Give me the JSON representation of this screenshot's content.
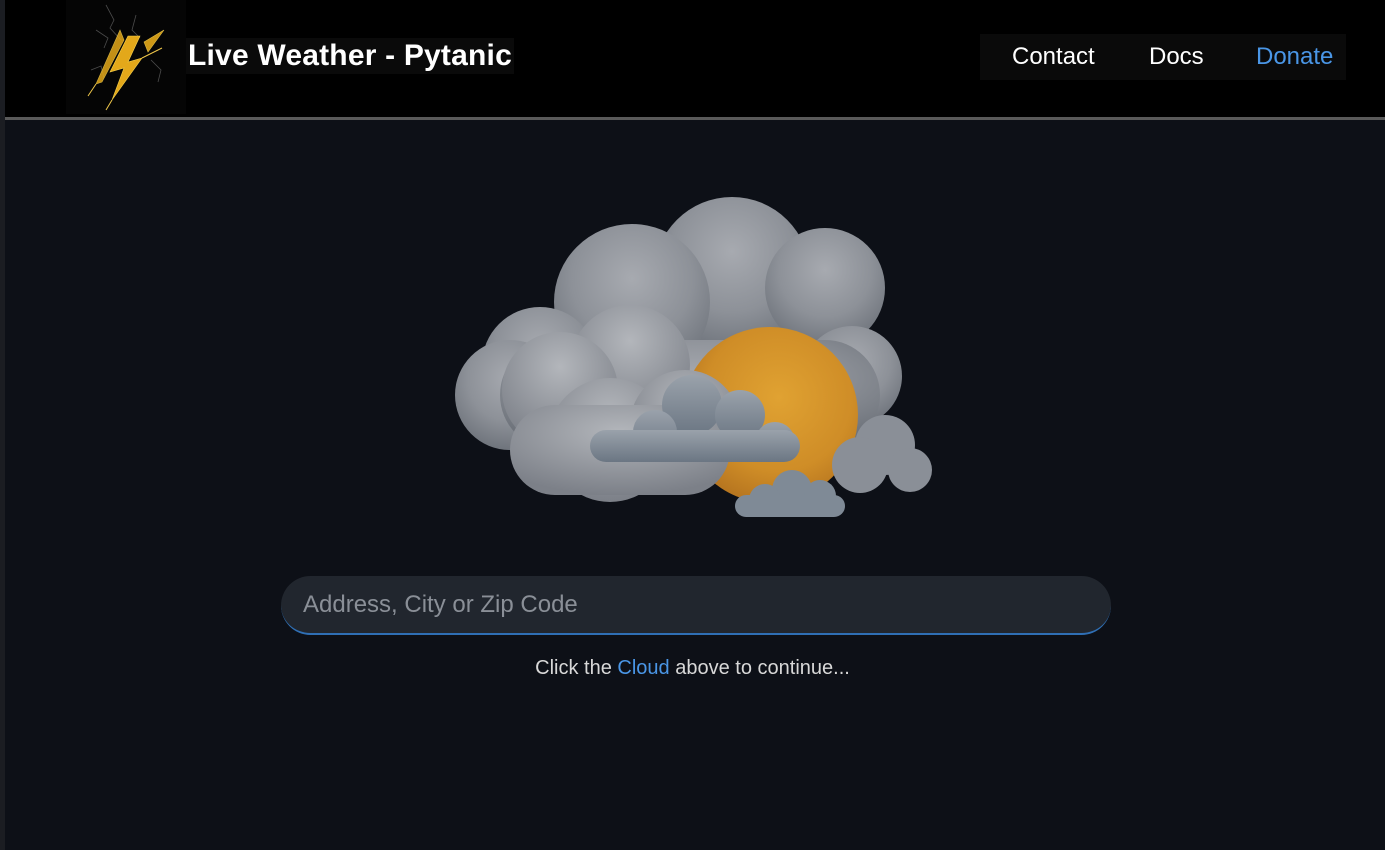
{
  "header": {
    "title": "Live Weather - Pytanic",
    "logo_icon": "lightning-logo-icon"
  },
  "nav": {
    "items": [
      {
        "label": "Contact"
      },
      {
        "label": "Docs"
      },
      {
        "label": "Donate"
      }
    ],
    "accent_color": "#4a96e6"
  },
  "hero": {
    "image_icon": "cloud-sun-icon"
  },
  "search": {
    "placeholder": "Address, City or Zip Code",
    "value": ""
  },
  "hint": {
    "prefix": "Click the ",
    "link": "Cloud",
    "suffix": " above to continue..."
  },
  "colors": {
    "background": "#0d1017",
    "header_bg": "#000000",
    "input_bg": "#21262e"
  }
}
